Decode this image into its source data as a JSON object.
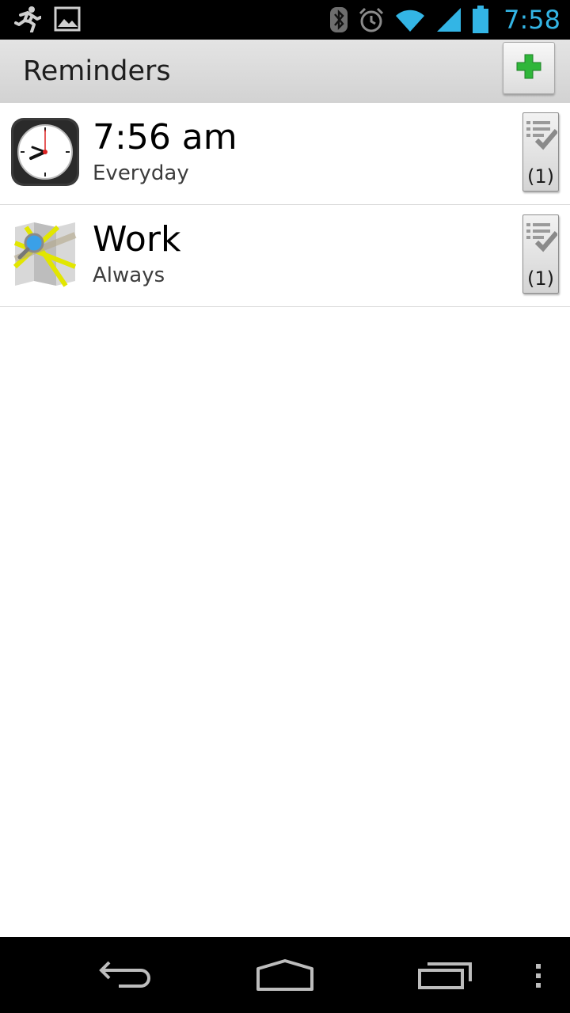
{
  "status_bar": {
    "time": "7:58",
    "left_icons": [
      "running-icon",
      "image-icon"
    ],
    "right_icons": [
      "bluetooth-icon",
      "alarm-icon",
      "wifi-icon",
      "signal-icon",
      "battery-icon"
    ],
    "accent_color": "#33b5e5"
  },
  "action_bar": {
    "title": "Reminders",
    "add_icon": "plus-icon"
  },
  "reminders": [
    {
      "title": "7:56 am",
      "subtitle": "Everyday",
      "icon": "clock-icon",
      "task_count": "(1)"
    },
    {
      "title": "Work",
      "subtitle": "Always",
      "icon": "map-icon",
      "task_count": "(1)"
    }
  ],
  "nav_bar": {
    "icons": [
      "back-icon",
      "home-icon",
      "recents-icon",
      "overflow-menu-icon"
    ]
  }
}
